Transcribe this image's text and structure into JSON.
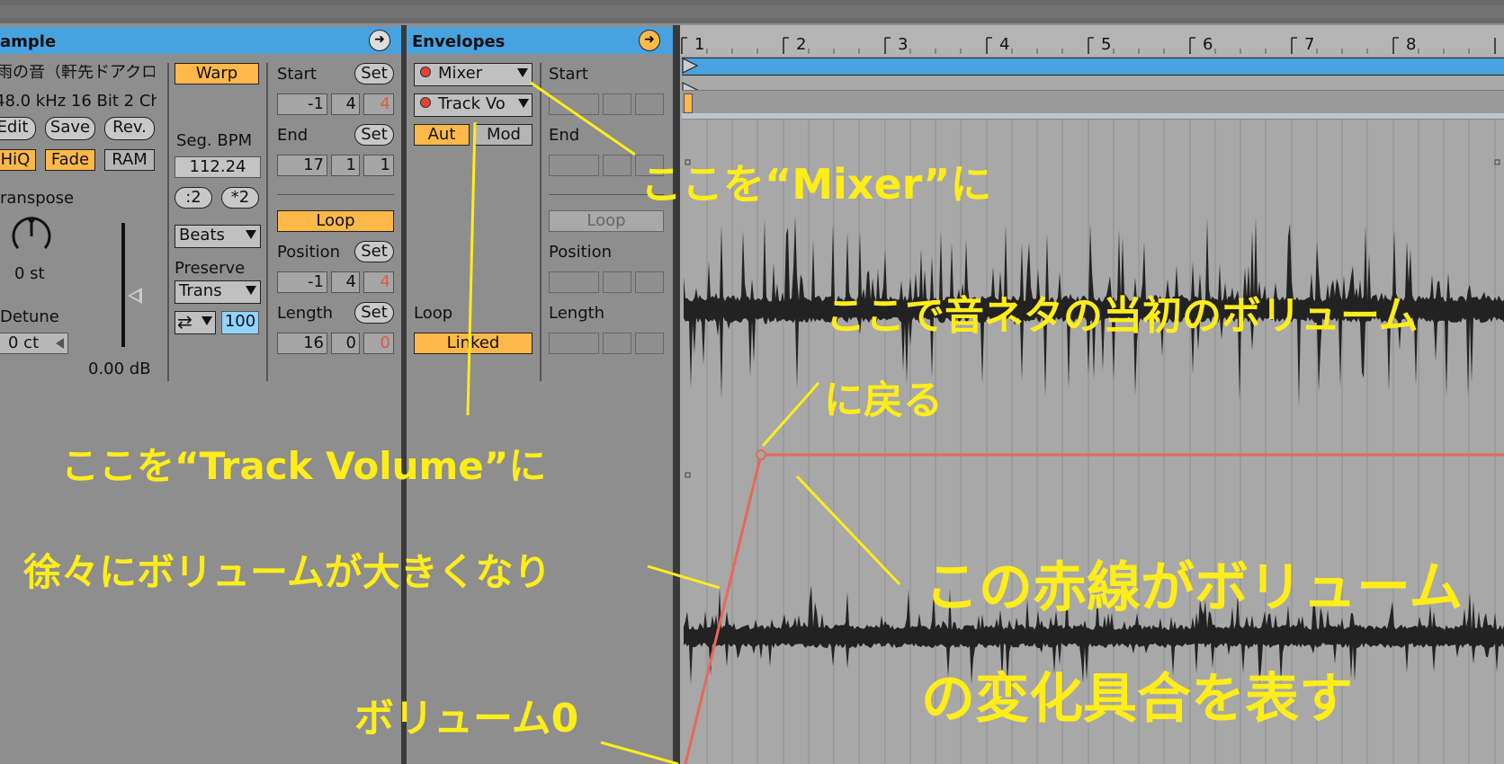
{
  "sample": {
    "header_title": "ample",
    "file_name": "雨の音（軒先ドアクロ",
    "format": "48.0 kHz 16 Bit 2 Ch",
    "edit_label": "Edit",
    "save_label": "Save",
    "rev_label": "Rev.",
    "hiq_label": "HiQ",
    "fade_label": "Fade",
    "ram_label": "RAM",
    "transpose_label": "ranspose",
    "transpose_value": "0 st",
    "detune_label": "Detune",
    "detune_value": "0 ct",
    "gain_value": "0.00 dB",
    "warp_label": "Warp",
    "seg_bpm_label": "Seg. BPM",
    "seg_bpm_value": "112.24",
    "half_label": ":2",
    "double_label": "*2",
    "warp_mode": "Beats",
    "preserve_label": "Preserve",
    "preserve_value": "Trans",
    "loop_mode_icon": "⇄",
    "envelope_value": "100",
    "start_label": "Start",
    "set_label": "Set",
    "start_values": [
      "-1",
      "4",
      "4"
    ],
    "end_label": "End",
    "end_values": [
      "17",
      "1",
      "1"
    ],
    "loop_label": "Loop",
    "position_label": "Position",
    "position_values": [
      "-1",
      "4",
      "4"
    ],
    "length_label": "Length",
    "length_values": [
      "16",
      "0",
      "0"
    ]
  },
  "envelopes": {
    "header_title": "Envelopes",
    "device_chooser": "Mixer",
    "control_chooser": "Track Vo",
    "aut_label": "Aut",
    "mod_label": "Mod",
    "loop_label": "Loop",
    "linked_label": "Linked",
    "start_label": "Start",
    "end_label": "End",
    "loop_button": "Loop",
    "position_label": "Position",
    "length_label": "Length"
  },
  "ruler": {
    "bars": [
      "1",
      "2",
      "3",
      "4",
      "5",
      "6",
      "7",
      "8"
    ]
  },
  "annotations": {
    "mixer_note": "ここを“Mixer”に",
    "track_volume_note": "ここを“Track Volume”に",
    "volume_return_line1": "ここで音ネタの当初のボリューム",
    "volume_return_line2": "に戻る",
    "gradually_louder": "徐々にボリュームが大きくなり",
    "red_line_line1": "この赤線がボリューム",
    "red_line_line2": "の変化具合を表す",
    "volume_zero": "ボリューム0"
  },
  "colors": {
    "header_blue": "#46a3e0",
    "button_orange": "#ffb84a",
    "annotation_yellow": "#ffed1a",
    "automation_red": "#e8685a",
    "waveform": "#222222"
  }
}
